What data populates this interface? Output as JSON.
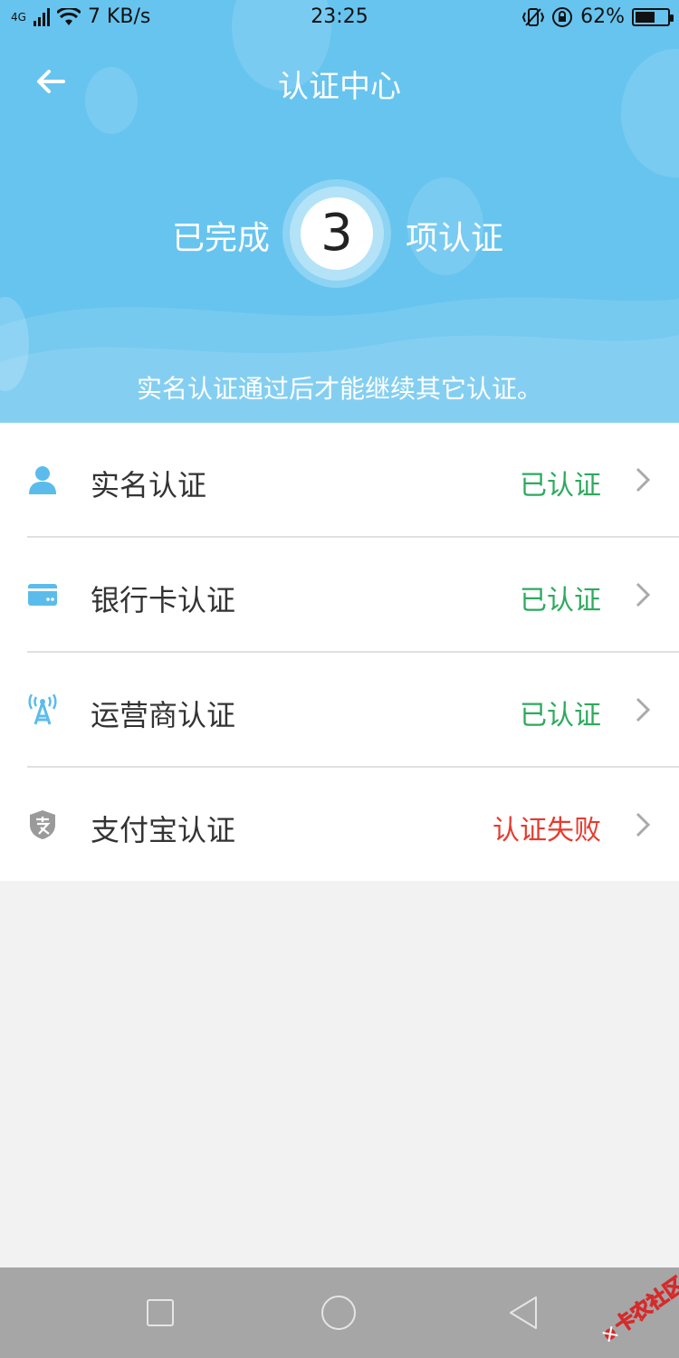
{
  "status_bar": {
    "network": "4G",
    "speed": "7 KB/s",
    "time": "23:25",
    "battery": "62%",
    "battery_level": 0.62
  },
  "header": {
    "title": "认证中心",
    "completed_prefix": "已完成",
    "completed_count": "3",
    "completed_suffix": "项认证",
    "hint": "实名认证通过后才能继续其它认证。"
  },
  "items": [
    {
      "label": "实名认证",
      "status": "已认证",
      "status_color": "#2daa5e",
      "icon": "person-icon"
    },
    {
      "label": "银行卡认证",
      "status": "已认证",
      "status_color": "#2daa5e",
      "icon": "bank-card-icon"
    },
    {
      "label": "运营商认证",
      "status": "已认证",
      "status_color": "#2daa5e",
      "icon": "signal-tower-icon"
    },
    {
      "label": "支付宝认证",
      "status": "认证失败",
      "status_color": "#e53b2e",
      "icon": "alipay-icon"
    }
  ],
  "watermark": "卡农社区",
  "colors": {
    "header_bg": "#67c4ef",
    "icon_blue": "#5bbcec",
    "icon_gray": "#9a9a9a"
  }
}
